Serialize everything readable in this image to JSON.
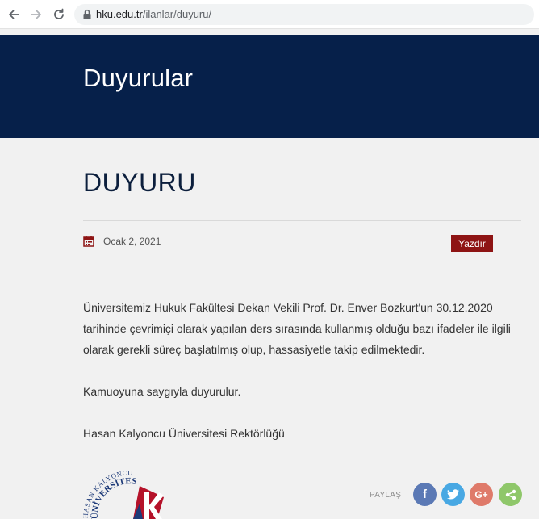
{
  "browser": {
    "url_host": "hku.edu.tr",
    "url_path": "/ilanlar/duyuru/"
  },
  "header": {
    "title": "Duyurular",
    "background_color": "#06204a"
  },
  "post": {
    "title": "DUYURU",
    "date": "Ocak 2, 2021",
    "print_label": "Yazdır",
    "print_color": "#8e1414",
    "paragraphs": [
      "Üniversitemiz Hukuk Fakültesi Dekan Vekili Prof. Dr. Enver Bozkurt'un 30.12.2020 tarihinde çevrimiçi olarak yapılan ders sırasında kullanmış olduğu bazı ifadeler ile ilgili olarak gerekli süreç başlatılmış olup, hassasiyetle takip edilmektedir.",
      "Kamuoyuna saygıyla duyurulur.",
      "Hasan Kalyoncu Üniversitesi Rektörlüğü"
    ]
  },
  "share": {
    "label": "PAYLAŞ",
    "buttons": [
      {
        "icon": "facebook-icon",
        "glyph": "f",
        "color": "#5b79b5"
      },
      {
        "icon": "twitter-icon",
        "color": "#48a8e3"
      },
      {
        "icon": "google-plus-icon",
        "glyph": "G+",
        "color": "#df7a6a"
      },
      {
        "icon": "share-icon",
        "color": "#8fc76a"
      }
    ]
  },
  "logo": {
    "icon": "university-logo",
    "text_top": "HASAN KALYONCU",
    "text_bottom": "ÜNİVERSİTESİ"
  }
}
